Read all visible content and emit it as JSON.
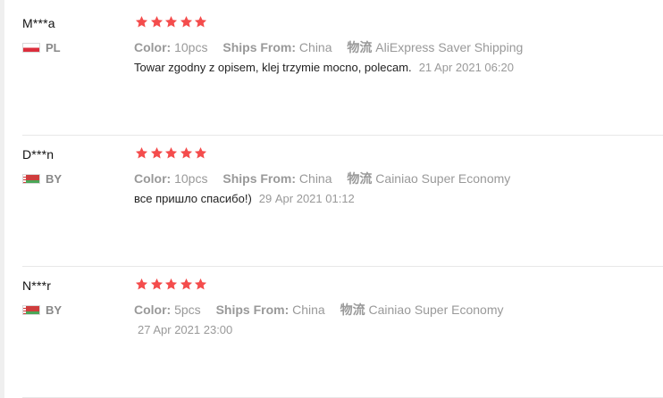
{
  "colors": {
    "star": "#f44c4c",
    "label": "#999999",
    "text": "#222222",
    "divider": "#e8e8e8"
  },
  "labels": {
    "color": "Color:",
    "ships_from": "Ships From:",
    "logistics": "物流"
  },
  "reviews": [
    {
      "buyer": "M***a",
      "country": "PL",
      "flag_icon": "poland-flag-icon",
      "rating": 5,
      "color_value": "10pcs",
      "ships_from_value": "China",
      "logistics_value": "AliExpress Saver Shipping",
      "text": "Towar zgodny z opisem, klej trzymie mocno, polecam.",
      "date": "21 Apr 2021 06:20"
    },
    {
      "buyer": "D***n",
      "country": "BY",
      "flag_icon": "belarus-flag-icon",
      "rating": 5,
      "color_value": "10pcs",
      "ships_from_value": "China",
      "logistics_value": "Cainiao Super Economy",
      "text": "все пришло спасибо!)",
      "date": "29 Apr 2021 01:12"
    },
    {
      "buyer": "N***r",
      "country": "BY",
      "flag_icon": "belarus-flag-icon",
      "rating": 5,
      "color_value": "5pcs",
      "ships_from_value": "China",
      "logistics_value": "Cainiao Super Economy",
      "text": "",
      "date": "27 Apr 2021 23:00"
    }
  ]
}
